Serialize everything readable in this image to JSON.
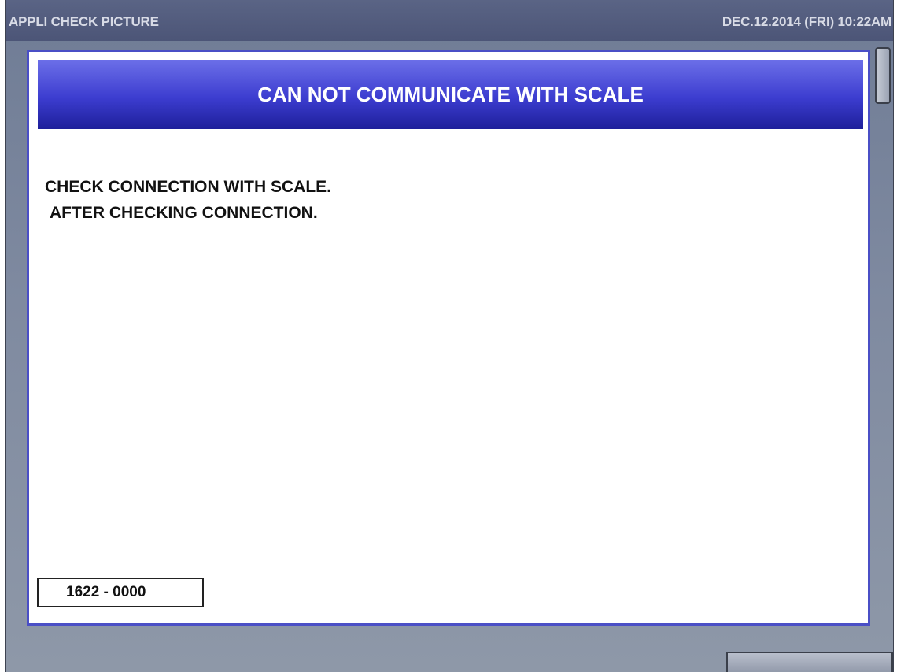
{
  "titlebar": {
    "app_title": "APPLI CHECK PICTURE",
    "datetime": "DEC.12.2014 (FRI)  10:22AM"
  },
  "dialog": {
    "header": "CAN NOT COMMUNICATE WITH SCALE",
    "message_line1": "CHECK CONNECTION WITH SCALE.",
    "message_line2": "AFTER CHECKING CONNECTION.",
    "error_code": "1622 - 0000"
  },
  "colors": {
    "dialog_border": "#4a4fc6",
    "header_top": "#6c6fe8",
    "header_bottom": "#1e1f9a",
    "background": "#7f8aa0"
  }
}
